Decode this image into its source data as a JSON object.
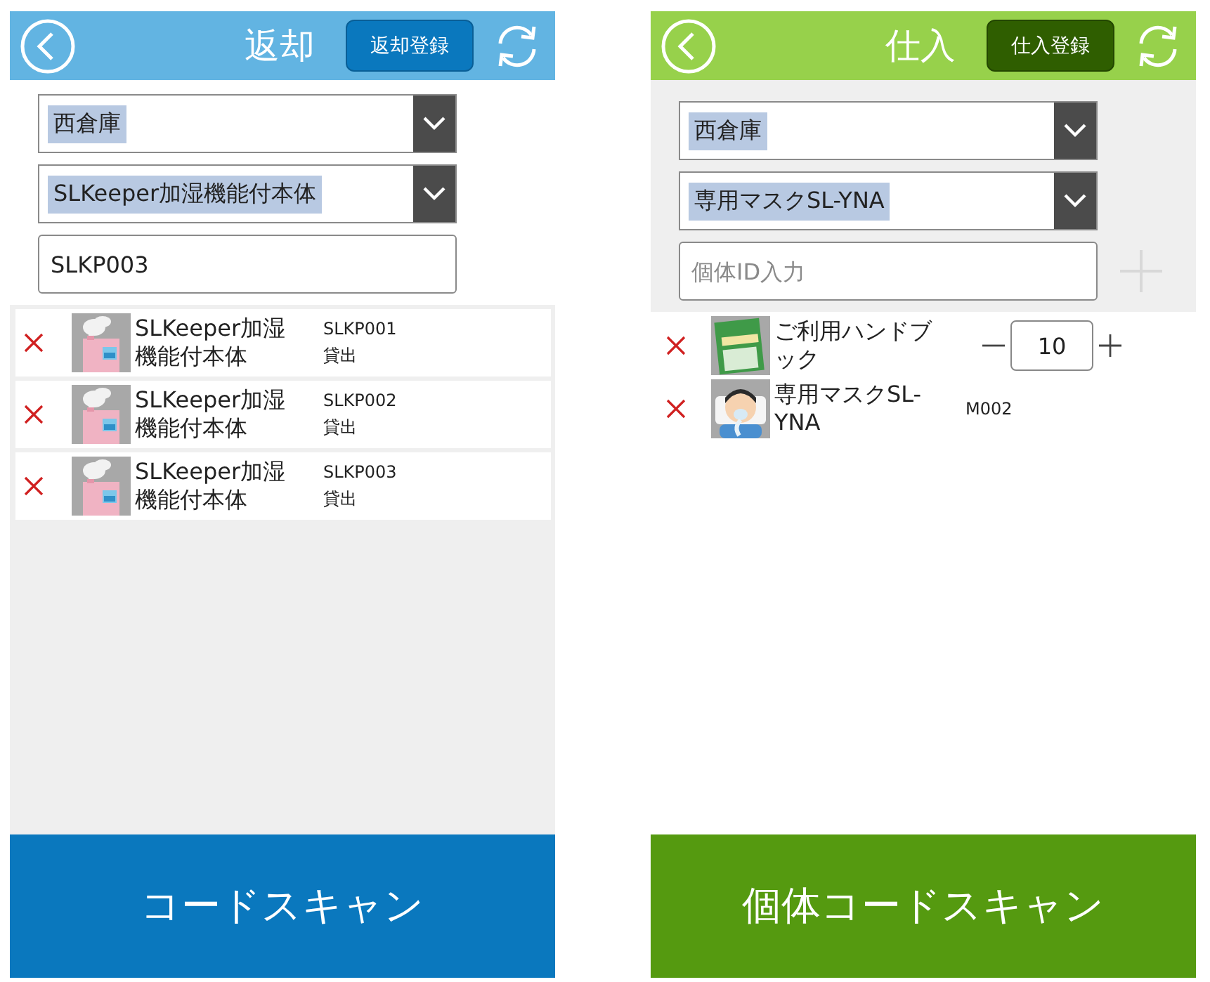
{
  "screens": [
    {
      "kind": "return",
      "title": "返却",
      "register_button": "返却登録",
      "warehouse": "西倉庫",
      "product": "SLKeeper加湿機能付本体",
      "id_field": {
        "value": "SLKP003"
      },
      "items": [
        {
          "kind": "serial",
          "name": "SLKeeper加湿機能付本体",
          "code": "SLKP001",
          "status": "貸出"
        },
        {
          "kind": "serial",
          "name": "SLKeeper加湿機能付本体",
          "code": "SLKP002",
          "status": "貸出"
        },
        {
          "kind": "serial",
          "name": "SLKeeper加湿機能付本体",
          "code": "SLKP003",
          "status": "貸出"
        }
      ],
      "scan_button": "コードスキャン"
    },
    {
      "kind": "purchase",
      "title": "仕入",
      "register_button": "仕入登録",
      "warehouse": "西倉庫",
      "product": "専用マスクSL-YNA",
      "id_field": {
        "placeholder": "個体ID入力"
      },
      "items": [
        {
          "kind": "quantity",
          "name": "ご利用ハンドブック",
          "quantity": "10"
        },
        {
          "kind": "serial",
          "name": "専用マスクSL-YNA",
          "code": "M002"
        }
      ],
      "scan_button": "個体コードスキャン"
    }
  ]
}
